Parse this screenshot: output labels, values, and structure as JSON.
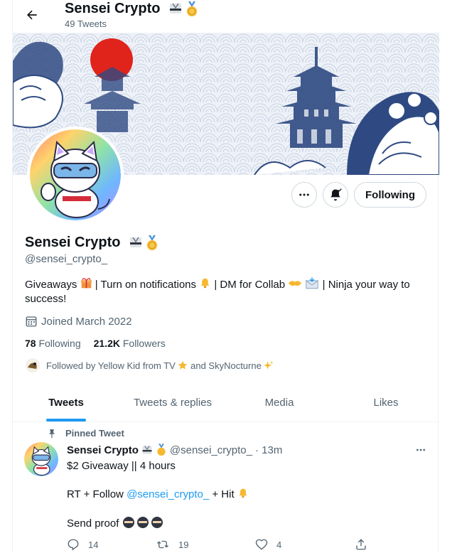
{
  "header": {
    "back_label": "Back",
    "name": "Sensei Crypto",
    "tweet_count": "49 Tweets"
  },
  "profile": {
    "name": "Sensei Crypto",
    "handle": "@sensei_crypto_",
    "bio_parts": {
      "a": "Giveaways",
      "b": "| Turn on notifications",
      "c": "| DM for Collab",
      "d": "| Ninja your way to success!"
    },
    "joined": "Joined March 2022",
    "following_count": "78",
    "following_label": "Following",
    "followers_count": "21.2K",
    "followers_label": "Followers",
    "followed_by": {
      "prefix": "Followed by Yellow Kid from TV",
      "middle": "and SkyNocturne"
    },
    "follow_button": "Following"
  },
  "tabs": [
    {
      "label": "Tweets",
      "active": true
    },
    {
      "label": "Tweets & replies",
      "active": false
    },
    {
      "label": "Media",
      "active": false
    },
    {
      "label": "Likes",
      "active": false
    }
  ],
  "tweet": {
    "pinned_label": "Pinned Tweet",
    "name": "Sensei Crypto",
    "handle": "@sensei_crypto_",
    "time": "· 13m",
    "line1": "$2 Giveaway || 4 hours",
    "line2_pre": "RT + Follow",
    "line2_link": "@sensei_crypto_",
    "line2_post": "+ Hit",
    "line3": "Send proof",
    "replies": "14",
    "retweets": "19",
    "likes": "4"
  },
  "colors": {
    "accent": "#1d9bf0",
    "text": "#0f1419",
    "muted": "#536471",
    "border": "#cfd9de"
  }
}
